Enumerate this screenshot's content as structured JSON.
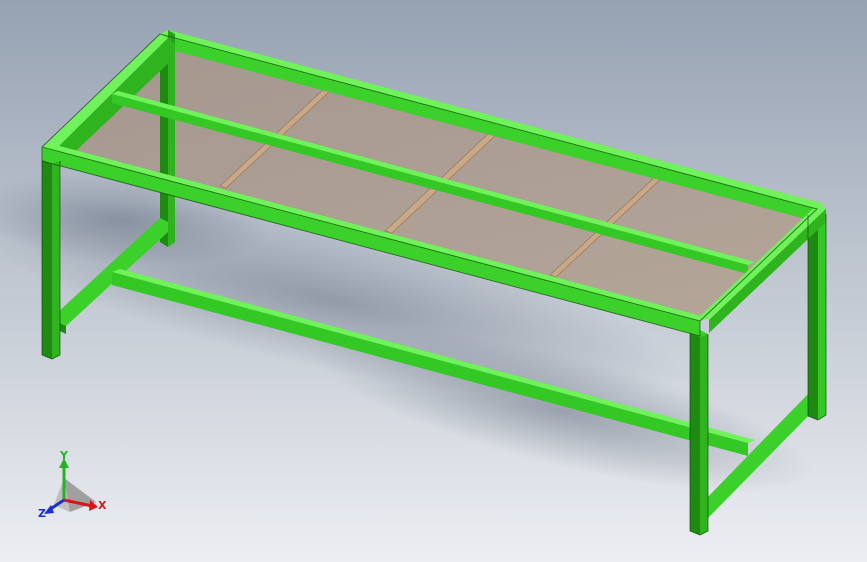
{
  "viewport": {
    "background_top": "#96a2b2",
    "background_bottom": "#e8ebf0"
  },
  "model": {
    "frame_color": "#3bd12a",
    "frame_color_dark": "#1f8a12",
    "frame_color_light": "#6ff25a",
    "panel_color": "#a99a8e",
    "slat_color": "#c9a888"
  },
  "triad": {
    "x_label": "X",
    "y_label": "Y",
    "z_label": "Z",
    "x_color": "#d8161a",
    "y_color": "#23b324",
    "z_color": "#1b2fd6"
  }
}
